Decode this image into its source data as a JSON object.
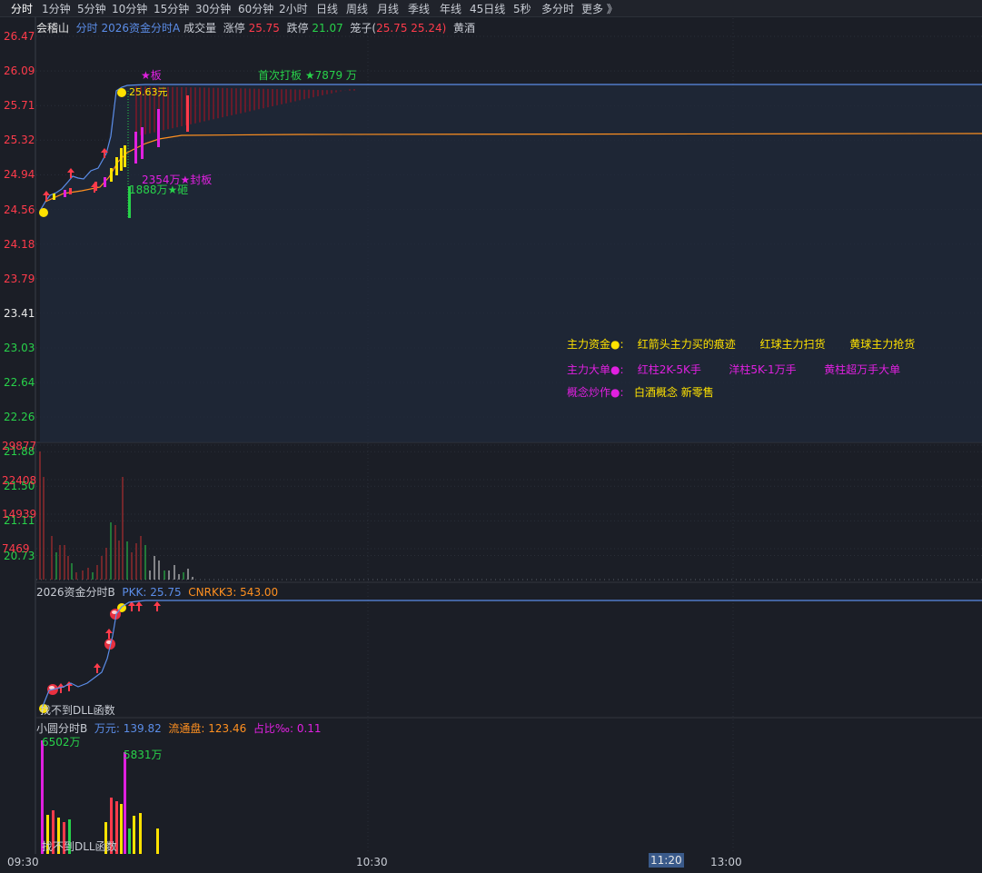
{
  "tabs": [
    "分时",
    "1分钟",
    "5分钟",
    "10分钟",
    "15分钟",
    "30分钟",
    "60分钟",
    "2小时",
    "日线",
    "周线",
    "月线",
    "季线",
    "年线",
    "45日线",
    "5秒",
    "多分时",
    "更多 》"
  ],
  "tab_active": "分时",
  "header": {
    "stock": "会稽山",
    "indicator": "分时 2026资金分时A",
    "volume_label": "成交量",
    "limit_up_label": "涨停",
    "limit_up": "25.75",
    "limit_down_label": "跌停",
    "limit_down": "21.07",
    "cage_label": "笼子(",
    "cage_values": "25.75 25.24)",
    "sector": "黄酒"
  },
  "price_axis": [
    {
      "v": "26.47",
      "c": "red"
    },
    {
      "v": "26.09",
      "c": "red"
    },
    {
      "v": "25.71",
      "c": "red"
    },
    {
      "v": "25.32",
      "c": "red"
    },
    {
      "v": "24.94",
      "c": "red"
    },
    {
      "v": "24.56",
      "c": "red"
    },
    {
      "v": "24.18",
      "c": "red"
    },
    {
      "v": "23.79",
      "c": "red"
    },
    {
      "v": "23.41",
      "c": "white"
    },
    {
      "v": "23.03",
      "c": "green"
    },
    {
      "v": "22.64",
      "c": "green"
    },
    {
      "v": "22.26",
      "c": "green"
    },
    {
      "v": "21.88",
      "c": "green"
    },
    {
      "v": "21.50",
      "c": "green"
    },
    {
      "v": "21.11",
      "c": "green"
    },
    {
      "v": "20.73",
      "c": "green"
    }
  ],
  "volume_axis": [
    "29877",
    "22408",
    "14939",
    "7469"
  ],
  "annotations": {
    "star_board": "★板",
    "first_board": "首次打板 ★7879 万",
    "price_tag": "25.63元",
    "seal_board": "2354万★封板",
    "tag_1888": "1888万★砸"
  },
  "legend": {
    "row1_title": "主力资金●:",
    "row1_a": "红箭头主力买的痕迹",
    "row1_b": "红球主力扫货",
    "row1_c": "黄球主力抢货",
    "row2_title": "主力大单●:",
    "row2_a": "红柱2K-5K手",
    "row2_b": "洋柱5K-1万手",
    "row2_c": "黄柱超万手大单",
    "row3_title": "概念炒作●:",
    "row3_a": "白酒概念 新零售"
  },
  "panel_b": {
    "name": "2026资金分时B",
    "pkk": "PKK: 25.75",
    "cnrkk": "CNRKK3: 543.00",
    "dll_note": "找不到DLL函数"
  },
  "panel_c": {
    "name": "小圆分时B",
    "wan": "万元: 139.82",
    "float": "流通盘: 123.46",
    "ratio": "占比‰: 0.11",
    "tag_6502": "6502万",
    "tag_5831": "5831万",
    "dll_note": "找不到DLL函数"
  },
  "time_axis": [
    "09:30",
    "10:30",
    "11:20",
    "13:00"
  ],
  "colors": {
    "bg": "#1b1e26",
    "grid": "#2c303a",
    "red": "#ff3b4b",
    "green": "#28d24a",
    "magenta": "#e020e0",
    "yellow": "#ffe200",
    "blue": "#5b8de8",
    "orange": "#ff9020"
  }
}
